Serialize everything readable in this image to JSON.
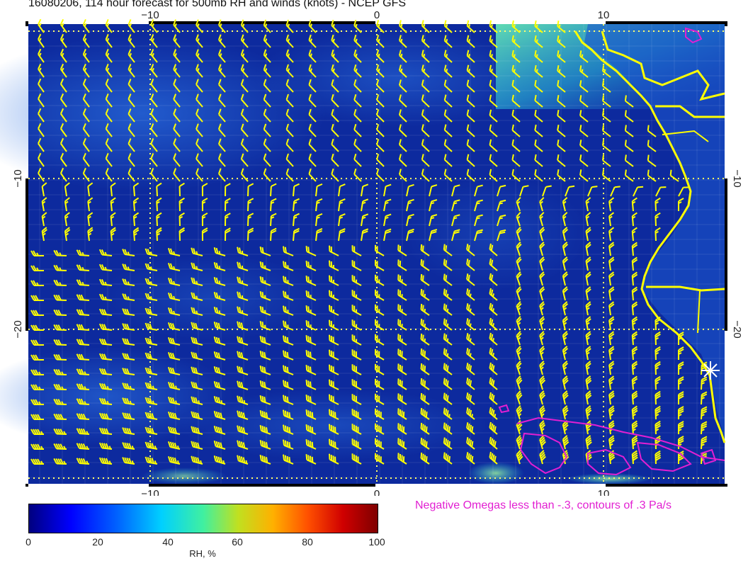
{
  "title": "16080206, 114 hour forecast for 500mb RH and winds (knots) - NCEP GFS",
  "map": {
    "lon_range": [
      -15.5,
      15.5
    ],
    "lat_range": [
      -30,
      -1
    ],
    "lon_ticks": [
      {
        "value": -10,
        "label": "−10"
      },
      {
        "value": 0,
        "label": "0"
      },
      {
        "value": 10,
        "label": "10"
      }
    ],
    "lat_ticks": [
      {
        "value": -10,
        "label": "−10"
      },
      {
        "value": -20,
        "label": "−20"
      }
    ],
    "fill_colors": {
      "ocean_low": "#0a1890",
      "mid": "#1f5fd8",
      "high": "#2bd0c8",
      "coast_fill": "#2a9ee8"
    },
    "barb_color": "#ffff00",
    "coast_color": "#ffff00",
    "omega_color": "#e21fd2",
    "grid": true,
    "station_marker": "white-star-marker"
  },
  "colorbar": {
    "label": "RH, %",
    "ticks": [
      "0",
      "20",
      "40",
      "60",
      "80",
      "100"
    ]
  },
  "omega_note": "Negative Omegas less than -.3, contours of .3 Pa/s"
}
